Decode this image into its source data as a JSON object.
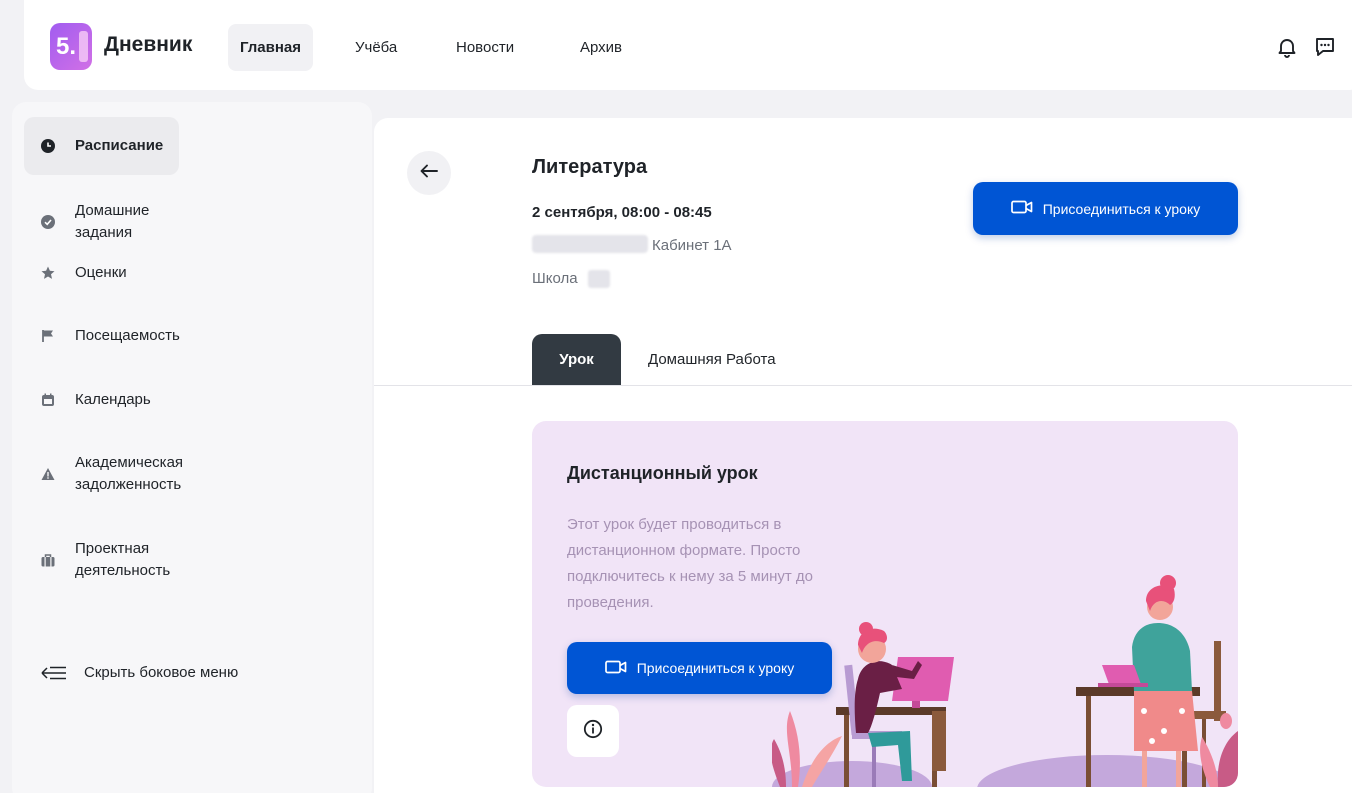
{
  "header": {
    "logo_text": "5.",
    "app_title": "Дневник",
    "nav": [
      {
        "label": "Главная",
        "active": true
      },
      {
        "label": "Учёба",
        "active": false
      },
      {
        "label": "Новости",
        "active": false
      },
      {
        "label": "Архив",
        "active": false
      }
    ],
    "icons": [
      "bell-icon",
      "chat-icon"
    ]
  },
  "sidebar": {
    "items": [
      {
        "label": "Расписание",
        "icon": "clock-icon",
        "active": true
      },
      {
        "label": "Домашние задания",
        "icon": "check-circle-icon",
        "active": false
      },
      {
        "label": "Оценки",
        "icon": "star-icon",
        "active": false
      },
      {
        "label": "Посещаемость",
        "icon": "flag-icon",
        "active": false
      },
      {
        "label": "Календарь",
        "icon": "calendar-icon",
        "active": false
      },
      {
        "label": "Академическая задолженность",
        "icon": "warning-icon",
        "active": false
      },
      {
        "label": "Проектная деятельность",
        "icon": "briefcase-icon",
        "active": false
      }
    ],
    "collapse_label": "Скрыть боковое меню"
  },
  "lesson": {
    "title": "Литература",
    "time": "2 сентября, 08:00 - 08:45",
    "room": "Кабинет 1А",
    "school_label": "Школа",
    "join_label": "Присоединиться к уроку"
  },
  "tabs": [
    {
      "label": "Урок",
      "active": true
    },
    {
      "label": "Домашняя Работа",
      "active": false
    }
  ],
  "card": {
    "title": "Дистанционный урок",
    "text": "Этот урок будет проводиться в дистанционном формате. Просто подключитесь к нему за 5 минут до проведения.",
    "join_label": "Присоединиться к уроку"
  },
  "colors": {
    "accent": "#0055d4",
    "logo": "#b066ee",
    "card_bg": "#f1e4f7",
    "tab_active": "#323a42"
  }
}
